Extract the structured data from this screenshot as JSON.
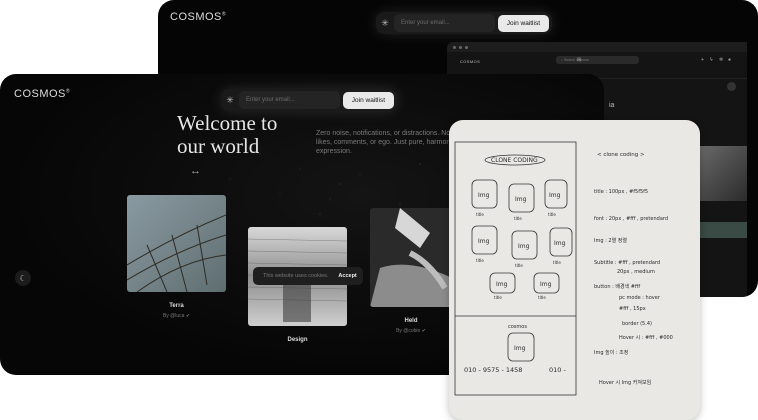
{
  "back_window": {
    "logo": "COSMOS",
    "email_placeholder": "Enter your email...",
    "join_label": "Join waitlist",
    "app": {
      "logo": "COSMOS",
      "search_placeholder": "Search Cosmos",
      "profile_fragment": "ia"
    }
  },
  "front_window": {
    "logo": "COSMOS",
    "email_placeholder": "Enter your email...",
    "join_label": "Join waitlist",
    "headline_1": "Welcome to",
    "headline_2": "our world",
    "tagline": "Zero noise, notifications, or distractions. No likes, comments, or ego. Just pure, harmonious expression.",
    "arrow": "↔",
    "cards": [
      {
        "title": "Terra",
        "byline": "By @luca"
      },
      {
        "title": "Design",
        "byline": ""
      },
      {
        "title": "Held",
        "byline": "By @cobin"
      }
    ],
    "cookie_text": "This website uses cookies.",
    "accept_label": "Accept"
  },
  "sketch": {
    "title": "CLONE CODING",
    "img_label": "Img",
    "title_label": "title",
    "footer_label": "cosmos",
    "phone": "010 - 9575 - 1458",
    "phone_suffix": "010 -",
    "notes": [
      "< clone coding >",
      "title : 100px , #f5f5f5",
      "font : 20px , #fff , pretendard",
      "Img : 2열 정렬",
      "Subtitle : #fff , pretendard",
      "20px , medium",
      "button : 배경색 #fff",
      "pc mode : hover",
      "#fff , 15px",
      "border (5.4)",
      "Hover 시 : #fff , #000",
      "Img 높이 : 조정",
      "Hover 시 Img 커져보임"
    ]
  }
}
